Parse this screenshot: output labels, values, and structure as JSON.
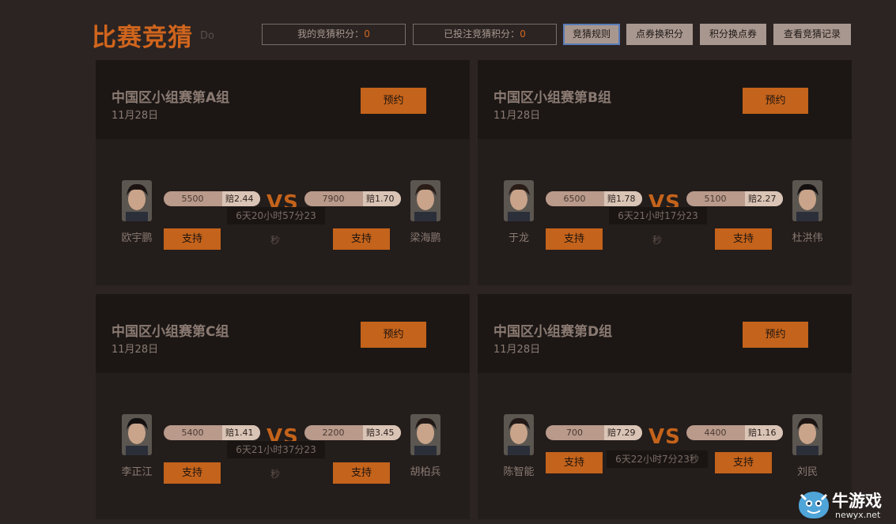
{
  "header": {
    "title": "比赛竞猜",
    "subtitle": "Do",
    "my_points": {
      "label": "我的竞猜积分：",
      "value": "0"
    },
    "bet_points": {
      "label": "已投注竞猜积分：",
      "value": "0"
    },
    "buttons": [
      "竞猜规则",
      "点券换积分",
      "积分换点券",
      "查看竞猜记录"
    ]
  },
  "matches": [
    {
      "title": "中国区小组赛第A组",
      "date": "11月28日",
      "reserve_label": "预约",
      "left": {
        "name": "欧宇鹏",
        "amount": "5500",
        "odds": "赔2.44"
      },
      "right": {
        "name": "梁海鹏",
        "amount": "7900",
        "odds": "赔1.70"
      },
      "vs": "VS",
      "countdown": "6天20小时57分23",
      "countdown_tail": "秒",
      "support_label": "支持"
    },
    {
      "title": "中国区小组赛第B组",
      "date": "11月28日",
      "reserve_label": "预约",
      "left": {
        "name": "于龙",
        "amount": "6500",
        "odds": "赔1.78"
      },
      "right": {
        "name": "杜洪伟",
        "amount": "5100",
        "odds": "赔2.27"
      },
      "vs": "VS",
      "countdown": "6天21小时17分23",
      "countdown_tail": "秒",
      "support_label": "支持"
    },
    {
      "title": "中国区小组赛第C组",
      "date": "11月28日",
      "reserve_label": "预约",
      "left": {
        "name": "李正江",
        "amount": "5400",
        "odds": "赔1.41"
      },
      "right": {
        "name": "胡柏兵",
        "amount": "2200",
        "odds": "赔3.45"
      },
      "vs": "VS",
      "countdown": "6天21小时37分23",
      "countdown_tail": "秒",
      "support_label": "支持"
    },
    {
      "title": "中国区小组赛第D组",
      "date": "11月28日",
      "reserve_label": "预约",
      "left": {
        "name": "陈智能",
        "amount": "700",
        "odds": "赔7.29"
      },
      "right": {
        "name": "刘民",
        "amount": "4400",
        "odds": "赔1.16"
      },
      "vs": "VS",
      "countdown": "6天22小时7分23秒",
      "countdown_tail": "",
      "support_label": "支持"
    }
  ],
  "watermark": {
    "brand": "牛游戏",
    "domain": "newyx.net"
  },
  "colors": {
    "accent": "#c4631b",
    "title": "#d0651d",
    "background": "#2b2422",
    "card": "#231d1b"
  }
}
